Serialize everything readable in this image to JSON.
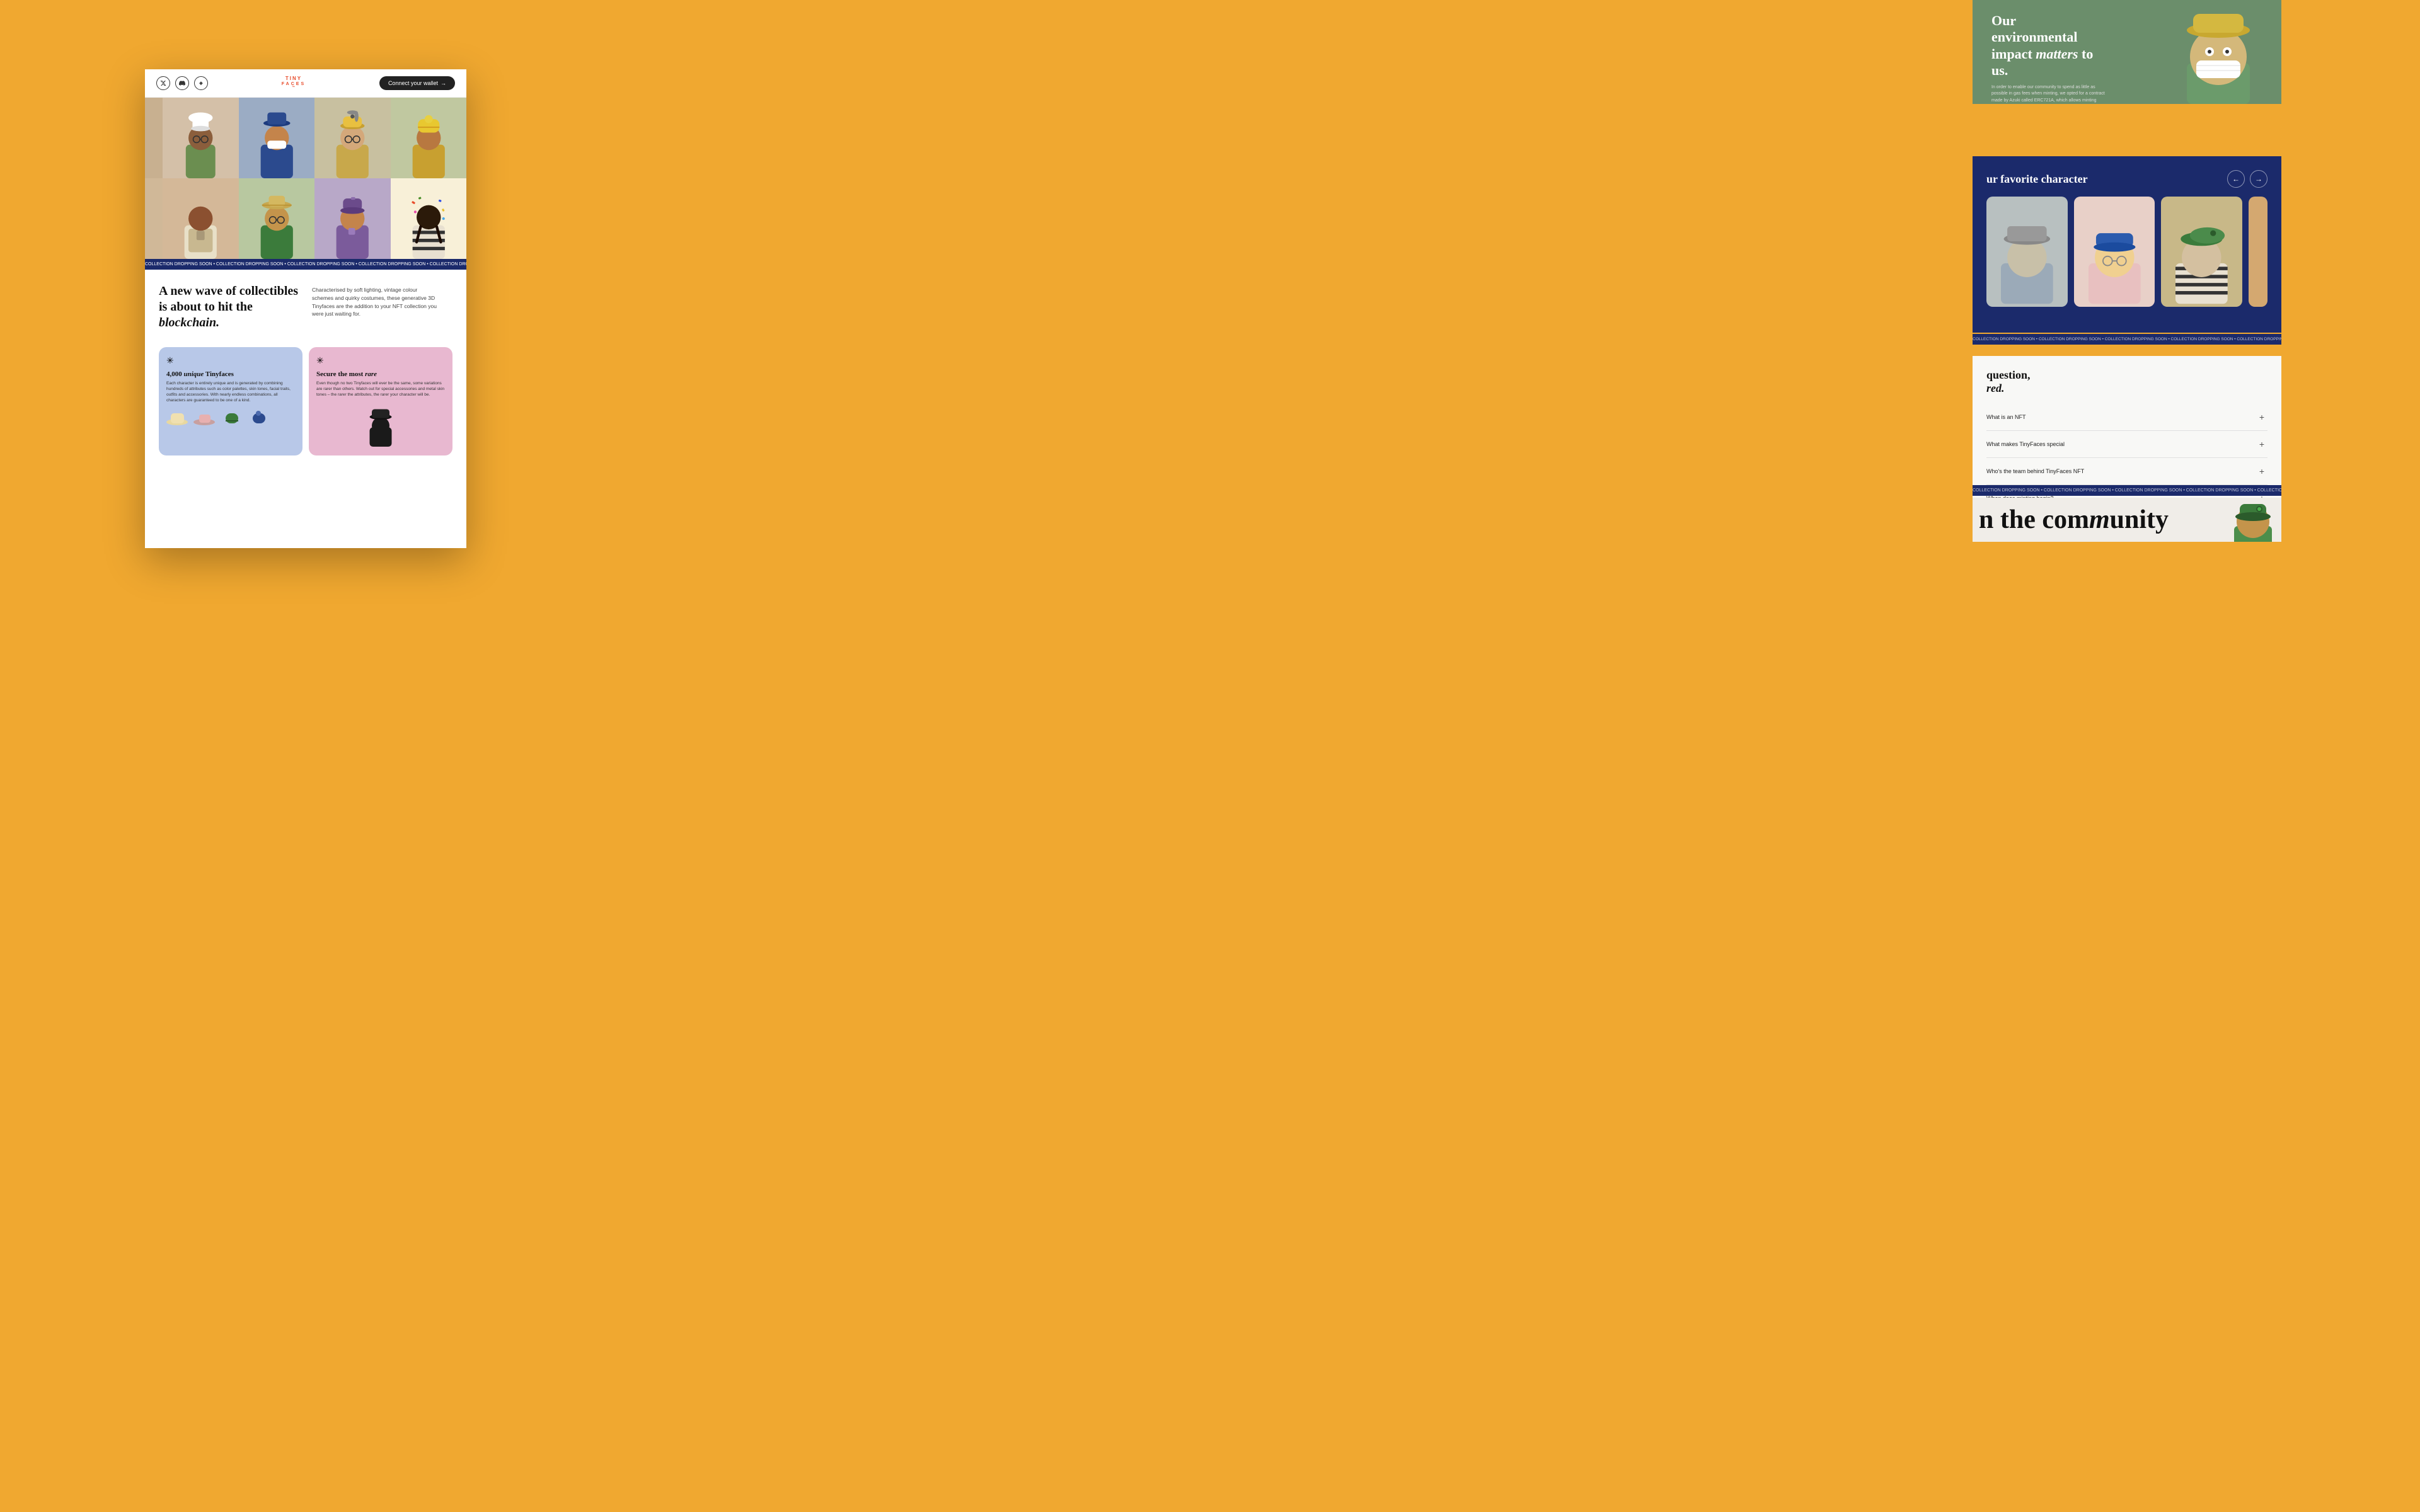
{
  "background_color": "#F0A830",
  "nav": {
    "logo_line1": "TINY",
    "logo_line2": "FACES",
    "connect_btn": "Connect your wallet",
    "icons": [
      "twitter",
      "discord",
      "opensea"
    ]
  },
  "ticker": {
    "text": "COLLECTION DROPPING SOON • COLLECTION DROPPING SOON • COLLECTION DROPPING SOON • COLLECTION DROPPING SOON • COLLECTION DROPPING SOON • COLLECTION DROPPING SOON • COLLECTION DROPPING SOON • "
  },
  "hero": {
    "headline_part1": "A new wave of collectibles is about to hit the ",
    "headline_italic": "blockchain.",
    "subtext": "Characterised by soft lighting, vintage colour schemes and quirky costumes, these generative 3D Tinyfaces are the addition to your NFT collection you were just waiting for."
  },
  "features": [
    {
      "id": "unique",
      "icon": "✳",
      "title_part1": "4,000 ",
      "title_italic": "unique",
      "title_part2": " Tinyfaces",
      "desc": "Each character is entirely unique and is generated by combining hundreds of attributes such as color palettes, skin tones, facial traits, outfits and accessories. With nearly endless combinations, all characters are guaranteed to be one of a kind.",
      "color": "blue"
    },
    {
      "id": "rare",
      "icon": "✳",
      "title_part1": "Secure the most ",
      "title_italic": "rare",
      "desc": "Even though no two Tinyfaces will ever be the same, some variations are rarer than others. Watch out for special accessories and metal skin tones – the rarer the attributes, the rarer your character will be.",
      "color": "pink"
    }
  ],
  "environmental": {
    "title_part1": "Our environmental impact ",
    "title_italic": "matters",
    "title_part2": " to us.",
    "desc": "In order to enable our community to spend as little as possible in gas fees when minting, we opted for a contract made by Azuki called ERC721A, which allows minting multiple NFTs for essentially the same cost of minting a single one."
  },
  "favorite": {
    "title": "ur favorite character",
    "nav_prev": "←",
    "nav_next": "→"
  },
  "faq": {
    "title_part1": "question,",
    "title_italic": "red.",
    "items": [
      {
        "q": "What is an NFT",
        "id": "faq-1"
      },
      {
        "q": "What makes TinyFaces special",
        "id": "faq-2"
      },
      {
        "q": "Who's the team behind TinyFaces NFT",
        "id": "faq-3"
      },
      {
        "q": "When does minting begin?",
        "id": "faq-4"
      }
    ]
  },
  "community": {
    "text_part1": "n the com",
    "text_italic": "m",
    "text_part2": "unity"
  },
  "characters": {
    "row1": [
      {
        "bg": "#C8B8A8",
        "hat": "chef",
        "skin": "#8B5E3C",
        "body": "#6B8E6B"
      },
      {
        "bg": "#9BB5C8",
        "hat": "brim",
        "skin": "#C4844B",
        "body": "#2B4A8E"
      },
      {
        "bg": "#D4C8B8",
        "hat": "propeller",
        "skin": "#D4A87A",
        "body": "#C8A84B"
      },
      {
        "bg": "#C8D0A8",
        "hat": "pompom",
        "skin": "#B87840",
        "body": "#C8A030"
      },
      {
        "bg": "#C8A878",
        "hat": "none",
        "skin": "#6B4028",
        "body": "#8E4B2B"
      }
    ],
    "row2": [
      {
        "bg": "#D4B898",
        "hat": "none",
        "skin": "#8B5030",
        "body": "#E8E0C8"
      },
      {
        "bg": "#B8C8A0",
        "hat": "straw",
        "skin": "#C4944B",
        "body": "#3B7B3B"
      },
      {
        "bg": "#B8A8C8",
        "hat": "cap",
        "skin": "#C4844B",
        "body": "#7B5B9B"
      },
      {
        "bg": "#F0E8D0",
        "hat": "none",
        "skin": "#2B1A0A",
        "body": "#E8E0D0"
      },
      {
        "bg": "#C8C0A8",
        "hat": "flat",
        "skin": "#8B6840",
        "body": "#2B4A6B"
      }
    ]
  }
}
